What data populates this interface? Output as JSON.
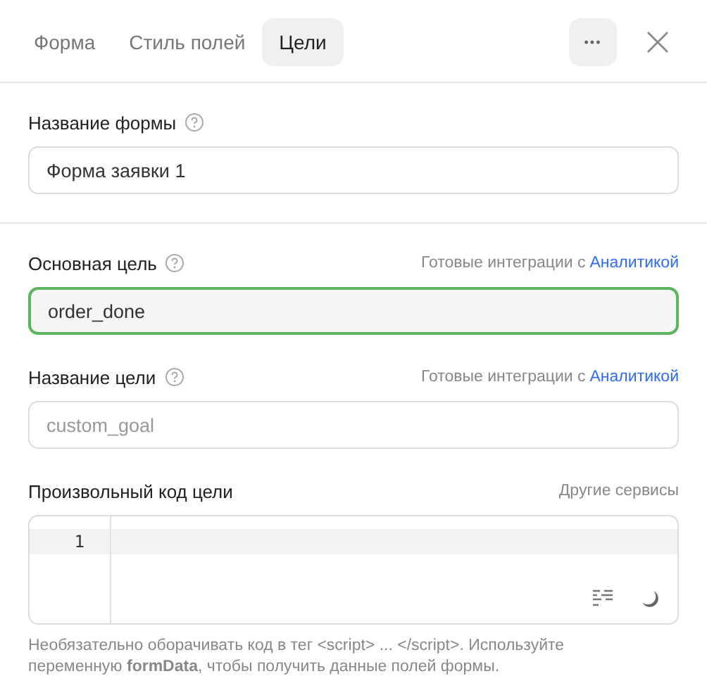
{
  "tabs": [
    {
      "label": "Форма",
      "selected": false
    },
    {
      "label": "Стиль полей",
      "selected": false
    },
    {
      "label": "Цели",
      "selected": true
    }
  ],
  "header_actions": {
    "more": "•••"
  },
  "form_name": {
    "label": "Название формы",
    "value": "Форма заявки 1"
  },
  "goals": [
    {
      "label": "Основная цель",
      "hint": "Готовые интеграции с",
      "link": "Аналитикой",
      "value": "order_done",
      "focused": true
    },
    {
      "label": "Название цели",
      "hint": "Готовые интеграции с",
      "link": "Аналитикой",
      "placeholder": "custom_goal",
      "focused": false
    }
  ],
  "custom_code": {
    "label": "Произвольный код цели",
    "hint": "Другие сервисы",
    "line_numbers": [
      "1"
    ],
    "help": "Необязательно оборачивать код в тег <script> ... </script>. Используйте переменную **formData**, чтобы получить данные полей формы."
  }
}
